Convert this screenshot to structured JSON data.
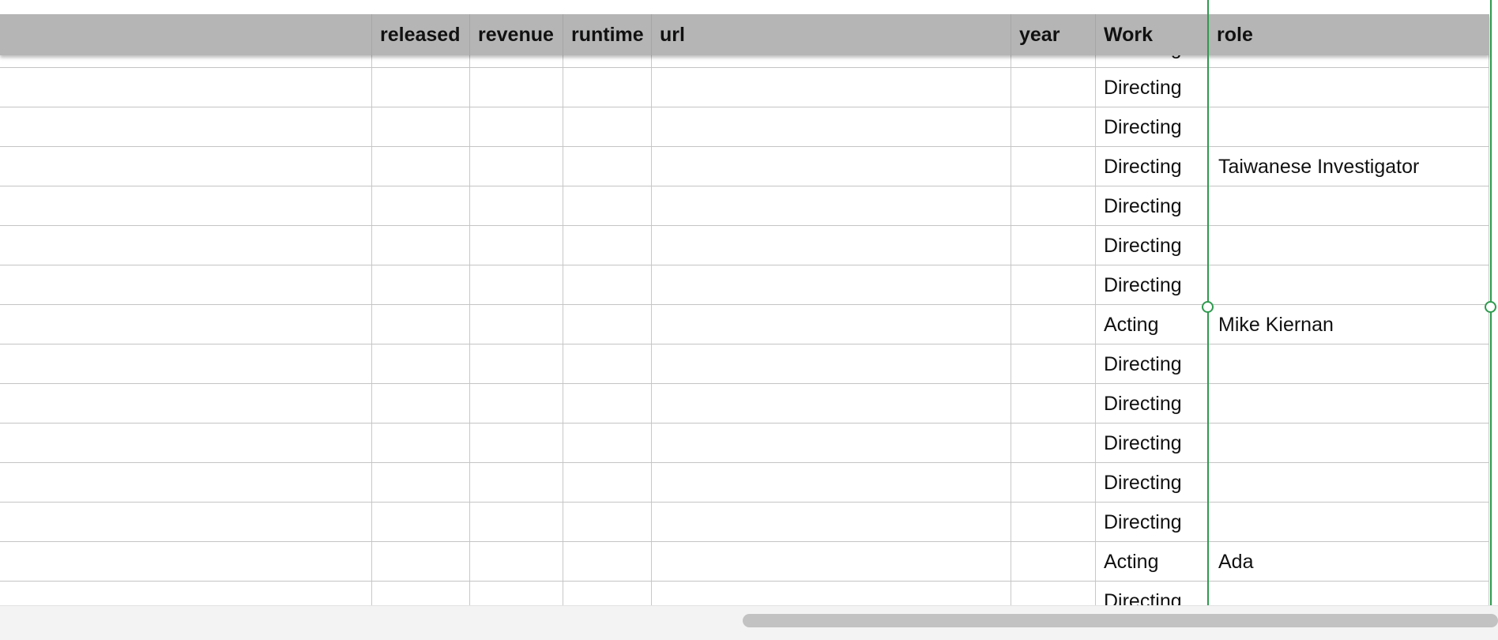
{
  "columns": [
    "released",
    "revenue",
    "runtime",
    "url",
    "year",
    "Work",
    "role"
  ],
  "rows": [
    {
      "work": "Directing",
      "role": ""
    },
    {
      "work": "Directing",
      "role": ""
    },
    {
      "work": "Directing",
      "role": ""
    },
    {
      "work": "Directing",
      "role": "Taiwanese Investigator"
    },
    {
      "work": "Directing",
      "role": ""
    },
    {
      "work": "Directing",
      "role": ""
    },
    {
      "work": "Directing",
      "role": ""
    },
    {
      "work": "Acting",
      "role": "Mike Kiernan"
    },
    {
      "work": "Directing",
      "role": ""
    },
    {
      "work": "Directing",
      "role": ""
    },
    {
      "work": "Directing",
      "role": ""
    },
    {
      "work": "Directing",
      "role": ""
    },
    {
      "work": "Directing",
      "role": ""
    },
    {
      "work": "Acting",
      "role": "Ada"
    },
    {
      "work": "Directing",
      "role": ""
    }
  ],
  "colors": {
    "header_bg": "#b4b5b4",
    "selection": "#2e9a4e",
    "grid": "#c4c4c4"
  }
}
